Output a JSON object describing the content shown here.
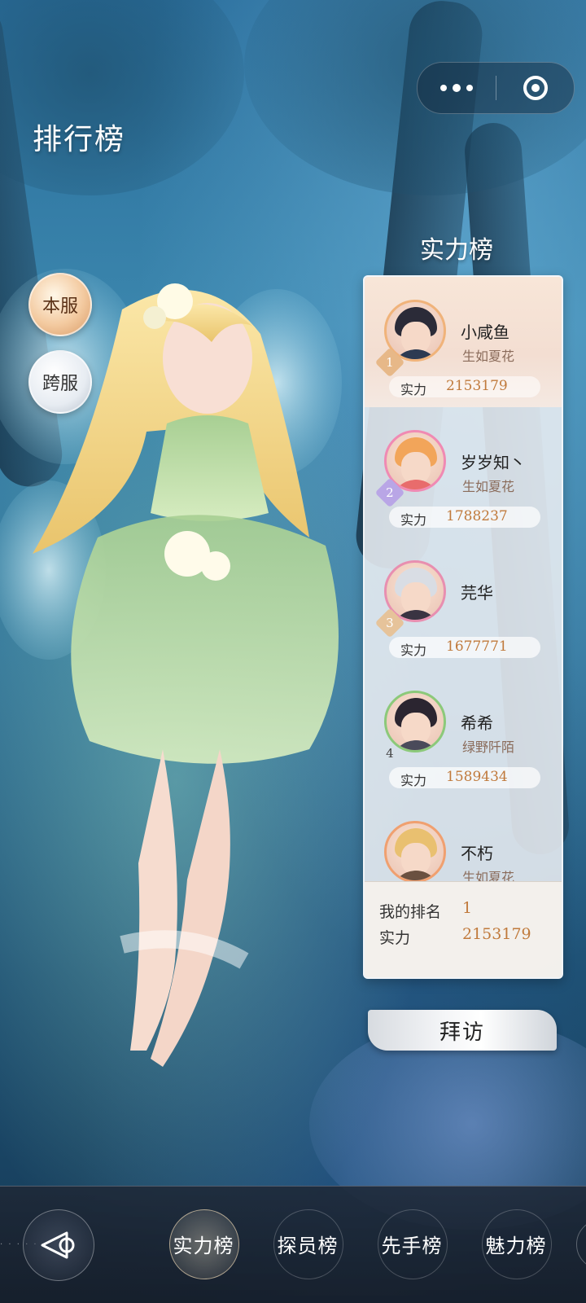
{
  "header": {
    "title": "排行榜"
  },
  "capsule": {
    "more_icon": "more-dots-icon",
    "close_icon": "target-circle-icon"
  },
  "server_tabs": {
    "local": "本服",
    "cross": "跨服"
  },
  "board": {
    "title": "实力榜",
    "power_label": "实力",
    "entries": [
      {
        "rank": "1",
        "name": "小咸鱼",
        "guild": "生如夏花",
        "power": "2153179"
      },
      {
        "rank": "2",
        "name": "岁岁知丶",
        "guild": "生如夏花",
        "power": "1788237"
      },
      {
        "rank": "3",
        "name": "芫华",
        "guild": "",
        "power": "1677771"
      },
      {
        "rank": "4",
        "name": "希希",
        "guild": "绿野阡陌",
        "power": "1589434"
      },
      {
        "rank": "",
        "name": "不朽",
        "guild": "生如夏花",
        "power": ""
      }
    ],
    "my_rank": {
      "rank_label": "我的排名",
      "rank_value": "1",
      "power_label": "实力",
      "power_value": "2153179"
    }
  },
  "visit_button": "拜访",
  "bottom_tabs": [
    {
      "label": "实力榜",
      "active": true
    },
    {
      "label": "探员榜",
      "active": false
    },
    {
      "label": "先手榜",
      "active": false
    },
    {
      "label": "魅力榜",
      "active": false
    }
  ],
  "colors": {
    "accent": "#c07a3c",
    "board_bg": "#ebeef2",
    "first_row_bg": "#f8e6d8",
    "bottom_bar": "#1e2837"
  }
}
